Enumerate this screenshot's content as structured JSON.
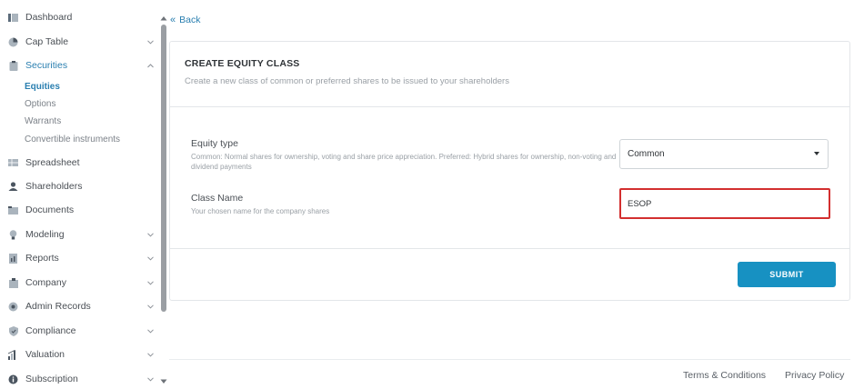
{
  "sidebar": {
    "items": [
      {
        "label": "Dashboard",
        "icon": "dashboard-icon",
        "chevron": ""
      },
      {
        "label": "Cap Table",
        "icon": "pie-chart-icon",
        "chevron": "down"
      },
      {
        "label": "Securities",
        "icon": "clipboard-icon",
        "chevron": "up",
        "active": true
      },
      {
        "label": "Spreadsheet",
        "icon": "spreadsheet-icon",
        "chevron": ""
      },
      {
        "label": "Shareholders",
        "icon": "person-icon",
        "chevron": ""
      },
      {
        "label": "Documents",
        "icon": "folder-icon",
        "chevron": ""
      },
      {
        "label": "Modeling",
        "icon": "lightbulb-icon",
        "chevron": "down"
      },
      {
        "label": "Reports",
        "icon": "report-icon",
        "chevron": "down"
      },
      {
        "label": "Company",
        "icon": "building-icon",
        "chevron": "down"
      },
      {
        "label": "Admin Records",
        "icon": "admin-icon",
        "chevron": "down"
      },
      {
        "label": "Compliance",
        "icon": "shield-icon",
        "chevron": "down"
      },
      {
        "label": "Valuation",
        "icon": "valuation-icon",
        "chevron": "down"
      },
      {
        "label": "Subscription",
        "icon": "info-icon",
        "chevron": "down"
      }
    ],
    "securities_sub": [
      {
        "label": "Equities",
        "active": true
      },
      {
        "label": "Options"
      },
      {
        "label": "Warrants"
      },
      {
        "label": "Convertible instruments"
      }
    ]
  },
  "back_label": "Back",
  "form": {
    "title": "CREATE EQUITY CLASS",
    "subtitle": "Create a new class of common or preferred shares to be issued to your shareholders",
    "equity_type": {
      "label": "Equity type",
      "help": "Common: Normal shares for ownership, voting and share price appreciation. Preferred: Hybrid shares for ownership, non-voting and dividend payments",
      "value": "Common"
    },
    "class_name": {
      "label": "Class Name",
      "help": "Your chosen name for the company shares",
      "value": "ESOP"
    },
    "submit_label": "SUBMIT"
  },
  "footer": {
    "terms": "Terms & Conditions",
    "privacy": "Privacy Policy"
  },
  "colors": {
    "accent": "#2a7fb0",
    "submit": "#1791c2",
    "error_border": "#d32f2f"
  }
}
